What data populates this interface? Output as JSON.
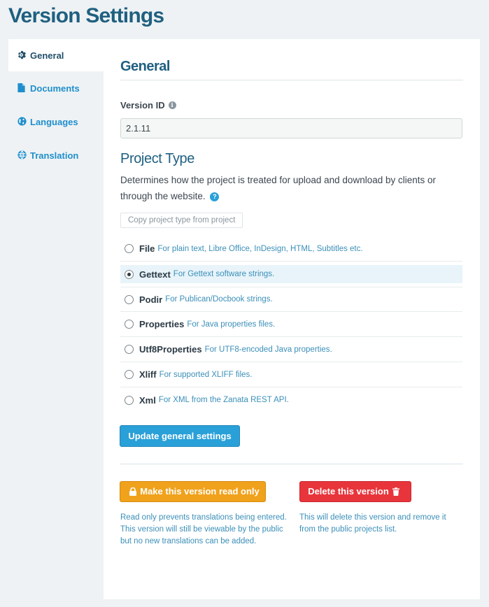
{
  "page": {
    "title": "Version Settings"
  },
  "sidebar": {
    "items": [
      {
        "label": "General",
        "icon": "gear-icon",
        "active": true
      },
      {
        "label": "Documents",
        "icon": "document-icon",
        "active": false
      },
      {
        "label": "Languages",
        "icon": "globe-icon",
        "active": false
      },
      {
        "label": "Translation",
        "icon": "translation-icon",
        "active": false
      }
    ]
  },
  "general": {
    "heading": "General",
    "version_id_label": "Version ID",
    "version_id_value": "2.1.11",
    "project_type_heading": "Project Type",
    "project_type_description": "Determines how the project is treated for upload and download by clients or through the website.",
    "copy_button": "Copy project type from project",
    "project_types": [
      {
        "name": "File",
        "description": "For plain text, Libre Office, InDesign, HTML, Subtitles etc.",
        "selected": false
      },
      {
        "name": "Gettext",
        "description": "For Gettext software strings.",
        "selected": true
      },
      {
        "name": "Podir",
        "description": "For Publican/Docbook strings.",
        "selected": false
      },
      {
        "name": "Properties",
        "description": "For Java properties files.",
        "selected": false
      },
      {
        "name": "Utf8Properties",
        "description": "For UTF8-encoded Java properties.",
        "selected": false
      },
      {
        "name": "Xliff",
        "description": "For supported XLIFF files.",
        "selected": false
      },
      {
        "name": "Xml",
        "description": "For XML from the Zanata REST API.",
        "selected": false
      }
    ],
    "update_button": "Update general settings",
    "readonly_button": "Make this version read only",
    "readonly_note": "Read only prevents translations being entered. This version will still be viewable by the public but no new translations can be added.",
    "delete_button": "Delete this version",
    "delete_note": "This will delete this version and remove it from the public projects list."
  },
  "colors": {
    "accent": "#2aa0d8",
    "heading": "#1f6080",
    "warning": "#f0a21c",
    "danger": "#e8353c"
  }
}
